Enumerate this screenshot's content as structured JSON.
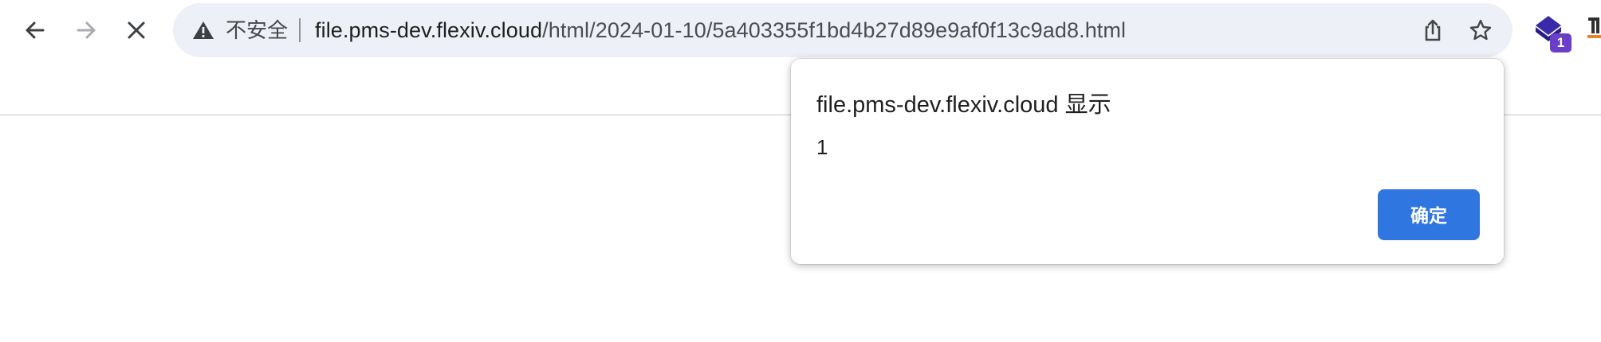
{
  "browser": {
    "nav": {
      "back_icon": "arrow-left-icon",
      "forward_icon": "arrow-right-icon",
      "stop_icon": "close-icon"
    },
    "omnibox": {
      "warning_icon": "warning-triangle-icon",
      "security_label": "不安全",
      "url_host": "file.pms-dev.flexiv.cloud",
      "url_path": "/html/2024-01-10/5a403355f1bd4b27d89e9af0f13c9ad8.html",
      "share_icon": "share-icon",
      "bookmark_icon": "star-icon"
    },
    "extension": {
      "icon": "extension-diamond-icon",
      "badge": "1"
    }
  },
  "dialog": {
    "title": "file.pms-dev.flexiv.cloud 显示",
    "message": "1",
    "ok_label": "确定"
  },
  "colors": {
    "omnibox_bg": "#edf0f6",
    "primary_button": "#2f76e0",
    "extension_badge": "#6b3fc5",
    "extension_icon": "#3b2aa8"
  }
}
